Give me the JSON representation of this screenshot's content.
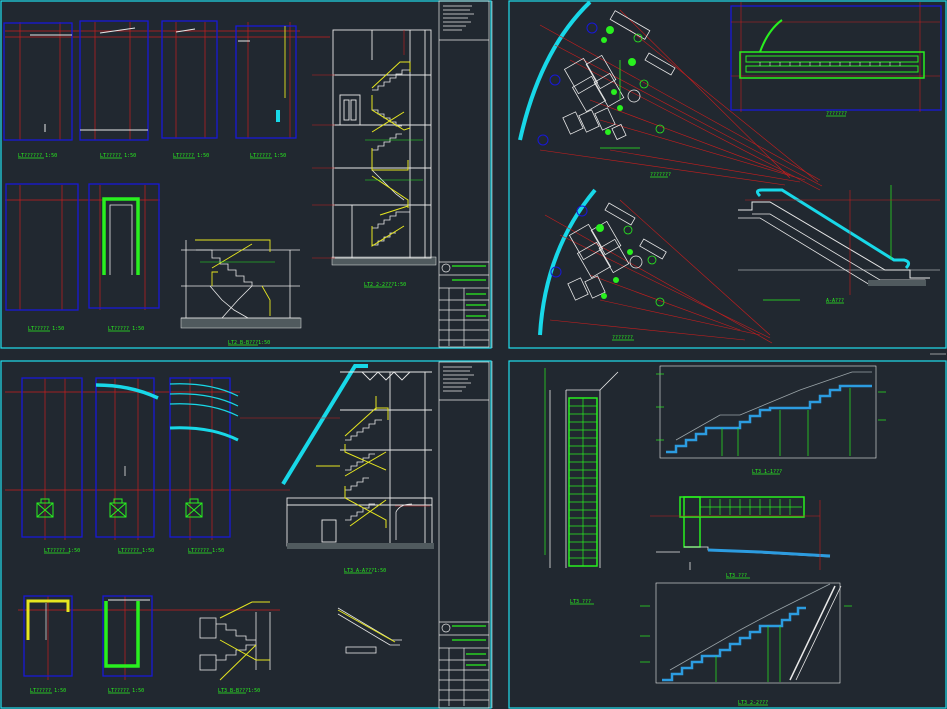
{
  "colors": {
    "background": "#212830",
    "frame": "#1fe0ee",
    "blue": "#1818d8",
    "red": "#c81e1e",
    "green": "#29f01f",
    "yellow": "#e6e620",
    "white": "#e8e8e8",
    "cyan": "#18d8e8",
    "grey": "#9aa4a8"
  },
  "sheet1": {
    "labels": [
      "LT?????? 1:50",
      "LT????? 1:50",
      "LT????? 1:50",
      "LT????? 1:50",
      "LT????? 1:50",
      "LT????? 1:50",
      "LT2 B-B???1:50",
      "LT2 2-2???1:50"
    ]
  },
  "sheet2": {
    "labels": [
      "???????",
      "???????",
      "???????",
      "A-A???"
    ]
  },
  "sheet3": {
    "labels": [
      "LT????? 1:50",
      "LT????? 1:50",
      "LT????? 1:50",
      "LT????? 1:50",
      "LT????? 1:50",
      "LT3 B-B???1:50",
      "LT3 A-A???1:50"
    ]
  },
  "sheet4": {
    "labels": [
      "LT3 ???",
      "LT3 1-1???",
      "LT3 ???",
      "LT3 2-2???"
    ]
  }
}
